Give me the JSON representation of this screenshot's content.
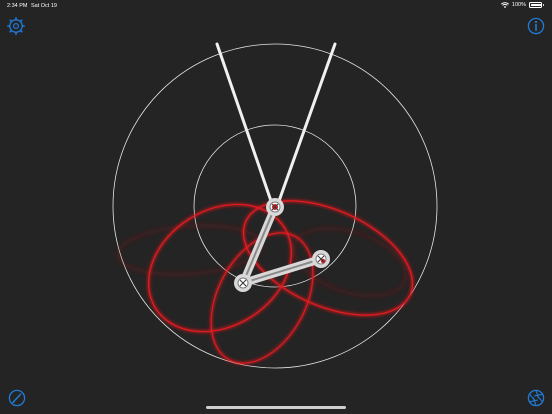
{
  "status_bar": {
    "time": "2:34 PM",
    "date": "Sat Oct 19",
    "battery_text": "100%",
    "battery_level": 1.0,
    "icons": [
      "wifi-icon",
      "battery-icon"
    ]
  },
  "toolbar": {
    "top_left_icon": "settings-gear-icon",
    "top_right_icon": "info-icon",
    "bottom_left_icon": "pencil-icon",
    "bottom_right_icon": "aperture-icon"
  },
  "colors": {
    "background": "#242424",
    "accent": "#1f7bd6",
    "trace": "#c8161b",
    "rod": "#f0f0f0",
    "guide_circle": "#e6e6e6"
  }
}
